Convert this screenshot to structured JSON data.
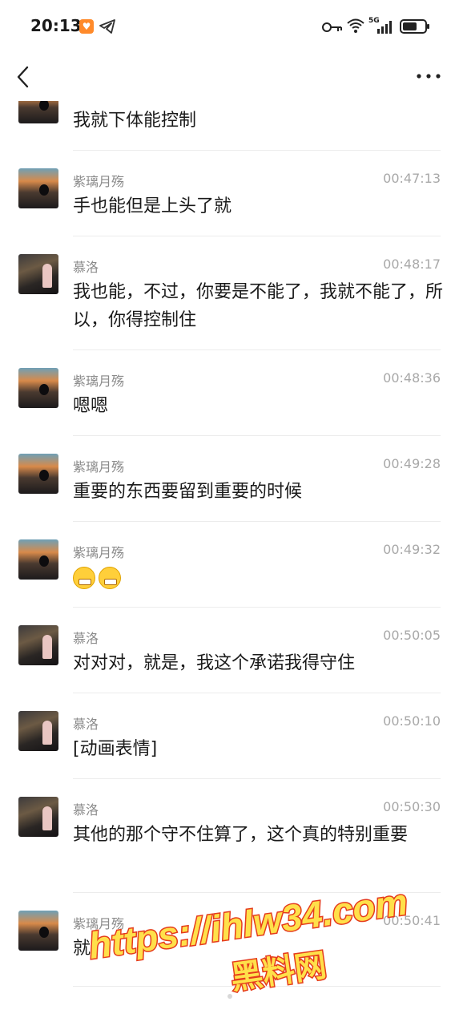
{
  "status_bar": {
    "time": "20:13",
    "app_badge": "♥",
    "network": "5G",
    "icons": [
      "telegram-icon",
      "key-icon",
      "wifi-icon",
      "signal-icon",
      "battery-icon"
    ]
  },
  "nav": {
    "back_icon": "chevron-left-icon",
    "more_icon": "more-dots-icon"
  },
  "first_message": {
    "text": "我就下体能控制"
  },
  "messages": [
    {
      "sender": "紫璃月殇",
      "time": "00:47:13",
      "text": "手也能但是上头了就"
    },
    {
      "sender": "慕洛",
      "time": "00:48:17",
      "text": "我也能，不过，你要是不能了，我就不能了，所以，你得控制住"
    },
    {
      "sender": "紫璃月殇",
      "time": "00:48:36",
      "text": "嗯嗯"
    },
    {
      "sender": "紫璃月殇",
      "time": "00:49:28",
      "text": "重要的东西要留到重要的时候"
    },
    {
      "sender": "紫璃月殇",
      "time": "00:49:32",
      "text": ""
    },
    {
      "sender": "慕洛",
      "time": "00:50:05",
      "text": "对对对，就是，我这个承诺我得守住"
    },
    {
      "sender": "慕洛",
      "time": "00:50:10",
      "text": "[动画表情]"
    },
    {
      "sender": "慕洛",
      "time": "00:50:30",
      "text": "其他的那个守不住算了，这个真的特别重要"
    },
    {
      "sender": "紫璃月殇",
      "time": "00:50:41",
      "text": "就"
    }
  ],
  "emojis": [
    "grin-emoji",
    "grin-emoji"
  ],
  "watermark": {
    "line1": "https://ihlw34.com",
    "line2": "黑料网"
  },
  "colors": {
    "watermark_fill": "#ffe04a",
    "watermark_stroke": "#e53b1b",
    "sender": "#8a8a8a",
    "time": "#a8a8a8"
  }
}
